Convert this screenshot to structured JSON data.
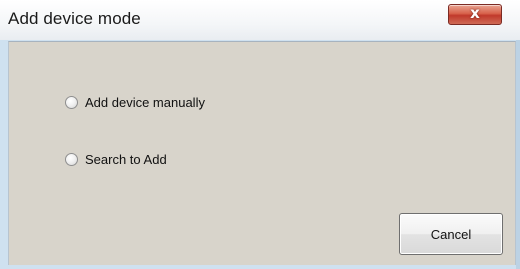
{
  "window": {
    "title": "Add device mode",
    "close_glyph": "x"
  },
  "options": [
    {
      "label": "Add device manually",
      "selected": false
    },
    {
      "label": "Search to Add",
      "selected": false
    }
  ],
  "buttons": {
    "cancel_label": "Cancel"
  },
  "colors": {
    "dialog_background": "#d8d4cb",
    "close_button": "#c0392b"
  }
}
